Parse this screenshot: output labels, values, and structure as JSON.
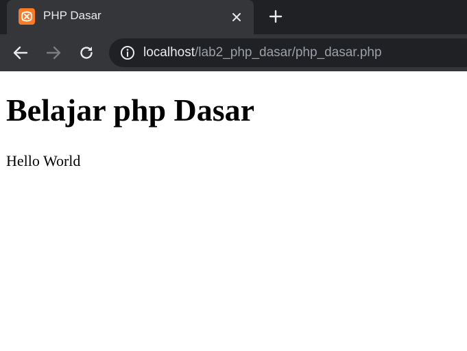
{
  "browser": {
    "tab": {
      "title": "PHP Dasar",
      "favicon": "xampp-logo-icon",
      "close_icon": "close-icon"
    },
    "new_tab_icon": "plus-icon",
    "toolbar": {
      "back_icon": "arrow-left-icon",
      "forward_icon": "arrow-right-icon",
      "reload_icon": "reload-icon",
      "info_icon": "info-icon"
    },
    "address": {
      "host": "localhost",
      "path": "/lab2_php_dasar/php_dasar.php"
    },
    "colors": {
      "tabbar_bg": "#202124",
      "active_tab_bg": "#35363a",
      "omnibox_bg": "#202124",
      "favicon": "#fb7a24"
    }
  },
  "page": {
    "heading": "Belajar php Dasar",
    "paragraph": "Hello World"
  }
}
